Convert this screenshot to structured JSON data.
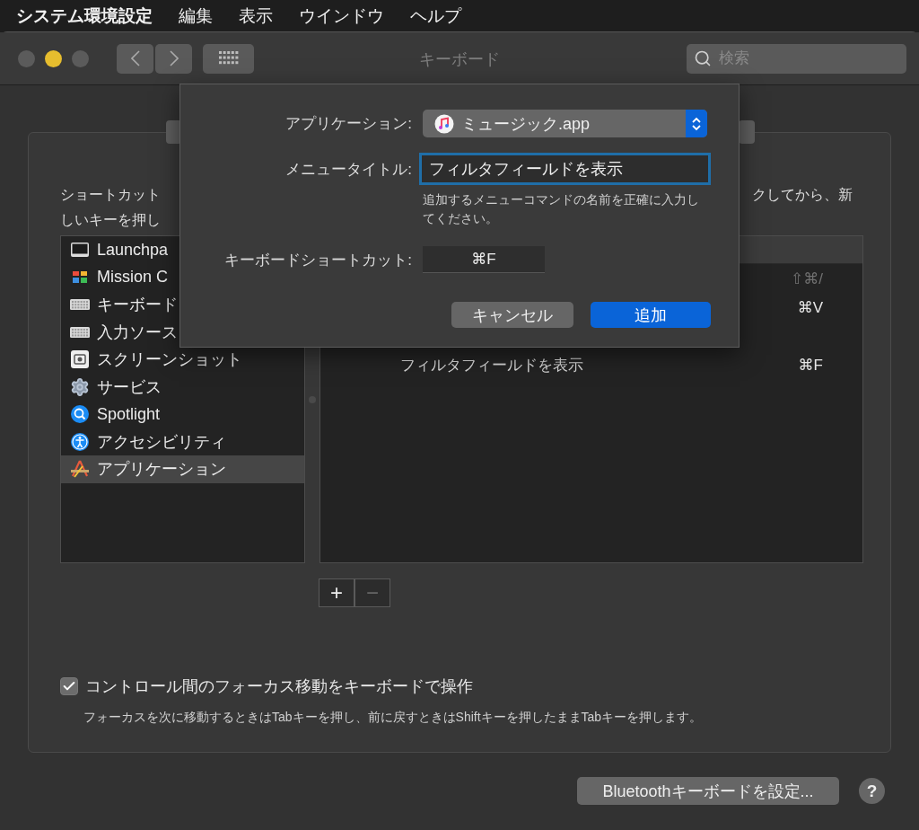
{
  "menubar": {
    "app": "システム環境設定",
    "items": [
      "編集",
      "表示",
      "ウインドウ",
      "ヘルプ"
    ]
  },
  "window": {
    "title": "キーボード",
    "search": {
      "placeholder": "検索"
    }
  },
  "description": {
    "left_lines": [
      "ショートカット",
      "しいキーを押し"
    ],
    "right_lines": [
      "クしてから、新"
    ]
  },
  "categories": [
    {
      "label": "Launchpa",
      "selected": false
    },
    {
      "label": "Mission C",
      "selected": false
    },
    {
      "label": "キーボード",
      "selected": false
    },
    {
      "label": "入力ソース",
      "selected": false
    },
    {
      "label": "スクリーンショット",
      "selected": false
    },
    {
      "label": "サービス",
      "selected": false
    },
    {
      "label": "Spotlight",
      "selected": false
    },
    {
      "label": "アクセシビリティ",
      "selected": false
    },
    {
      "label": "アプリケーション",
      "selected": true
    }
  ],
  "shortcuts": [
    {
      "shortcut": "⇧⌘/",
      "disabled": true
    },
    {
      "shortcut": "⌘V",
      "disabled": false
    },
    {
      "title": "フィルタフィールドを表示",
      "shortcut": "⌘F",
      "disabled": false
    }
  ],
  "list_buttons": {
    "add": "+",
    "remove": "−",
    "remove_disabled": true
  },
  "focus_option": {
    "label": "コントロール間のフォーカス移動をキーボードで操作",
    "checked": true,
    "note": "フォーカスを次に移動するときはTabキーを押し、前に戻すときはShiftキーを押したままTabキーを押します。"
  },
  "bluetooth_button": "Bluetoothキーボードを設定...",
  "help_button": "?",
  "sheet": {
    "application_label": "アプリケーション:",
    "application_value": "ミュージック.app",
    "menu_title_label": "メニュータイトル:",
    "menu_title_value": "フィルタフィールドを表示",
    "menu_title_hint": "追加するメニューコマンドの名前を正確に入力してください。",
    "shortcut_label": "キーボードショートカット:",
    "shortcut_value": "⌘F",
    "cancel": "キャンセル",
    "add": "追加"
  }
}
